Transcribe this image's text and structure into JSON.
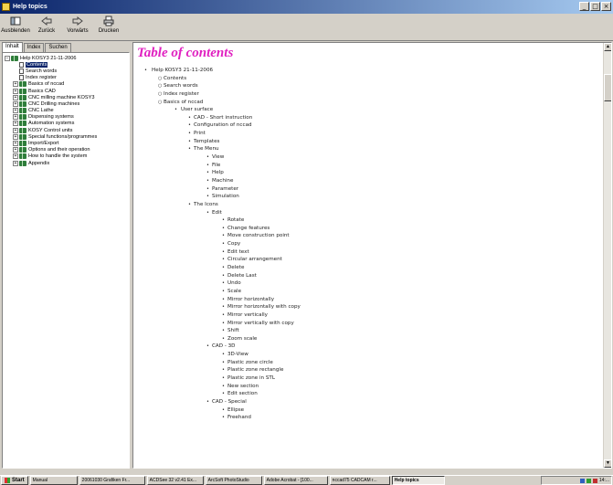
{
  "window": {
    "title": "Help topics"
  },
  "toolbar": [
    {
      "label": "Ausblenden",
      "icon": "hide-icon"
    },
    {
      "label": "Zurück",
      "icon": "back-arrow-icon"
    },
    {
      "label": "Vorwärts",
      "icon": "forward-arrow-icon"
    },
    {
      "label": "Drucken",
      "icon": "printer-icon"
    }
  ],
  "tabs": [
    "Inhalt",
    "Index",
    "Suchen"
  ],
  "tree": {
    "root": "Help KOSY3 21-11-2006",
    "items": [
      {
        "label": "Contents",
        "type": "page",
        "selected": true
      },
      {
        "label": "Search words",
        "type": "page"
      },
      {
        "label": "Index register",
        "type": "page"
      },
      {
        "label": "Basics of nccad",
        "type": "book"
      },
      {
        "label": "Basics CAD",
        "type": "book"
      },
      {
        "label": "CNC milling machine KOSY3",
        "type": "book"
      },
      {
        "label": "CNC Drilling machines",
        "type": "book"
      },
      {
        "label": "CNC Lathe",
        "type": "book"
      },
      {
        "label": "Dispensing systems",
        "type": "book"
      },
      {
        "label": "Automation systems",
        "type": "book"
      },
      {
        "label": "KOSY Control units",
        "type": "book"
      },
      {
        "label": "Special functions/programmes",
        "type": "book"
      },
      {
        "label": "Import/Export",
        "type": "book"
      },
      {
        "label": "Options and their operation",
        "type": "book"
      },
      {
        "label": "How to handle the system",
        "type": "book"
      },
      {
        "label": "Appendix",
        "type": "book"
      }
    ]
  },
  "content": {
    "title": "Table of contents",
    "toc": [
      {
        "level": 0,
        "text": "Help KOSY3 21-11-2006"
      },
      {
        "level": 1,
        "text": "Contents"
      },
      {
        "level": 1,
        "text": "Search words"
      },
      {
        "level": 1,
        "text": "Index register"
      },
      {
        "level": 1,
        "text": "Basics of nccad"
      },
      {
        "level": 2,
        "text": "User surface"
      },
      {
        "level": 3,
        "text": "CAD - Short instruction"
      },
      {
        "level": 3,
        "text": "Configuration of nccad"
      },
      {
        "level": 3,
        "text": "Print"
      },
      {
        "level": 3,
        "text": "Templates"
      },
      {
        "level": 3,
        "text": "The Menu"
      },
      {
        "level": 4,
        "text": "View"
      },
      {
        "level": 4,
        "text": "File"
      },
      {
        "level": 4,
        "text": "Help"
      },
      {
        "level": 4,
        "text": "Machine"
      },
      {
        "level": 4,
        "text": "Parameter"
      },
      {
        "level": 4,
        "text": "Simulation"
      },
      {
        "level": 3,
        "text": "The Icons"
      },
      {
        "level": 4,
        "text": "Edit"
      },
      {
        "level": 5,
        "text": "Rotate"
      },
      {
        "level": 5,
        "text": "Change features"
      },
      {
        "level": 5,
        "text": "Move construction point"
      },
      {
        "level": 5,
        "text": "Copy"
      },
      {
        "level": 5,
        "text": "Edit text"
      },
      {
        "level": 5,
        "text": "Circular arrangement"
      },
      {
        "level": 5,
        "text": "Delete"
      },
      {
        "level": 5,
        "text": "Delete Last"
      },
      {
        "level": 5,
        "text": "Undo"
      },
      {
        "level": 5,
        "text": "Scale"
      },
      {
        "level": 5,
        "text": "Mirror horizontally"
      },
      {
        "level": 5,
        "text": "Mirror horizontally with copy"
      },
      {
        "level": 5,
        "text": "Mirror vertically"
      },
      {
        "level": 5,
        "text": "Mirror vertically with copy"
      },
      {
        "level": 5,
        "text": "Shift"
      },
      {
        "level": 5,
        "text": "Zoom scale"
      },
      {
        "level": 4,
        "text": "CAD - 3D"
      },
      {
        "level": 5,
        "text": "3D-View"
      },
      {
        "level": 5,
        "text": "Plastic zone circle"
      },
      {
        "level": 5,
        "text": "Plastic zone rectangle"
      },
      {
        "level": 5,
        "text": "Plastic zone in STL"
      },
      {
        "level": 5,
        "text": "New section"
      },
      {
        "level": 5,
        "text": "Edit section"
      },
      {
        "level": 4,
        "text": "CAD - Special"
      },
      {
        "level": 5,
        "text": "Ellipse"
      },
      {
        "level": 5,
        "text": "Freehand"
      }
    ]
  },
  "taskbar": {
    "start": "Start",
    "tasks": [
      {
        "label": "Manual",
        "active": false
      },
      {
        "label": "20061030 Grafiken Fr...",
        "active": false
      },
      {
        "label": "ACDSee 32 v2.41 Ex...",
        "active": false
      },
      {
        "label": "ArcSoft PhotoStudio",
        "active": false
      },
      {
        "label": "Adobe Acrobat - [100...",
        "active": false
      },
      {
        "label": "nccad75 CADCAM r...",
        "active": false
      },
      {
        "label": "Help topics",
        "active": true
      }
    ],
    "clock": "14:..."
  }
}
